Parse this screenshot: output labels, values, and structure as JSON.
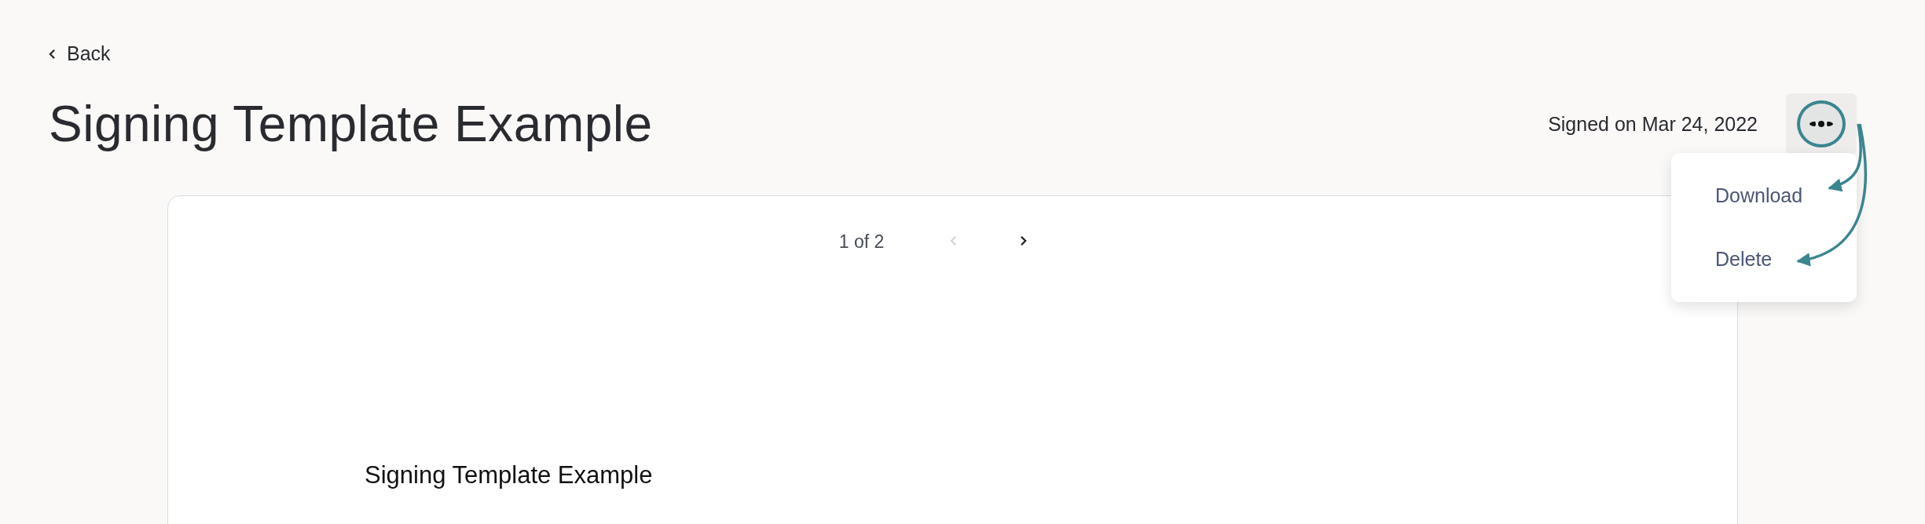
{
  "back": {
    "label": "Back"
  },
  "title": "Signing Template Example",
  "signed_text": "Signed on Mar 24, 2022",
  "more_menu": {
    "expanded": true,
    "items": [
      {
        "label": "Download"
      },
      {
        "label": "Delete"
      }
    ]
  },
  "document": {
    "pager": {
      "text": "1 of 2",
      "previous": {
        "disabled": true
      },
      "next": {
        "disabled": false
      }
    },
    "heading": "Signing Template Example"
  }
}
